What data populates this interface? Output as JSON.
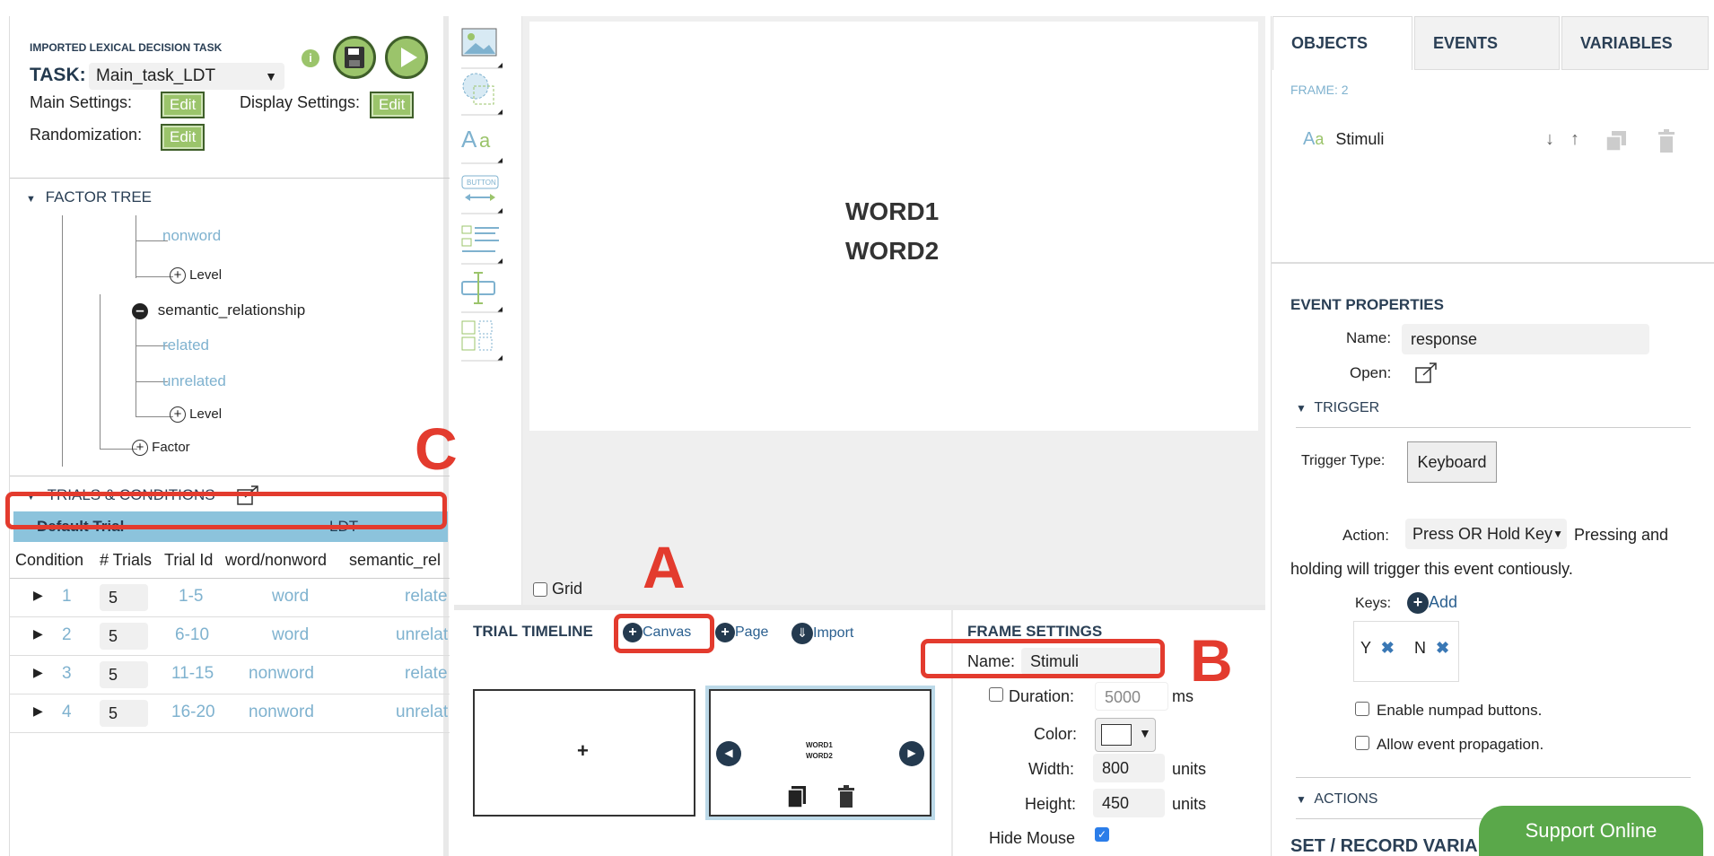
{
  "task": {
    "header": "IMPORTED LEXICAL DECISION TASK",
    "task_label": "TASK:",
    "task_value": "Main_task_LDT",
    "main_settings_label": "Main Settings:",
    "display_settings_label": "Display Settings:",
    "randomization_label": "Randomization:",
    "edit_label": "Edit"
  },
  "factor_tree": {
    "title": "FACTOR TREE",
    "items": [
      "nonword",
      "Level",
      "semantic_relationship",
      "related",
      "unrelated",
      "Level",
      "Factor"
    ]
  },
  "trials": {
    "title": "TRIALS & CONDITIONS",
    "default_trial": "Default Trial",
    "ldt": "LDT",
    "columns": [
      "Condition",
      "# Trials",
      "Trial Id",
      "word/nonword",
      "semantic_rel"
    ],
    "rows": [
      {
        "cond": "1",
        "n": "5",
        "id": "1-5",
        "wn": "word",
        "sem": "relate"
      },
      {
        "cond": "2",
        "n": "5",
        "id": "6-10",
        "wn": "word",
        "sem": "unrelat"
      },
      {
        "cond": "3",
        "n": "5",
        "id": "11-15",
        "wn": "nonword",
        "sem": "relate"
      },
      {
        "cond": "4",
        "n": "5",
        "id": "16-20",
        "wn": "nonword",
        "sem": "unrelat"
      }
    ]
  },
  "canvas": {
    "word1": "WORD1",
    "word2": "WORD2",
    "grid_label": "Grid"
  },
  "timeline": {
    "title": "TRIAL TIMELINE",
    "canvas_btn": "Canvas",
    "page_btn": "Page",
    "import_btn": "Import",
    "frame1_text": "+",
    "frame2_word1": "WORD1",
    "frame2_word2": "WORD2"
  },
  "frame_settings": {
    "title": "FRAME SETTINGS",
    "name_label": "Name:",
    "name_value": "Stimuli",
    "duration_label": "Duration:",
    "duration_value": "5000",
    "duration_unit": "ms",
    "color_label": "Color:",
    "width_label": "Width:",
    "width_value": "800",
    "height_label": "Height:",
    "height_value": "450",
    "units": "units",
    "hide_mouse_label": "Hide Mouse"
  },
  "right_panel": {
    "tabs": [
      "OBJECTS",
      "EVENTS",
      "VARIABLES"
    ],
    "frame_label": "FRAME: 2",
    "object_name": "Stimuli",
    "event_properties_title": "EVENT PROPERTIES",
    "name_label": "Name:",
    "name_value": "response",
    "open_label": "Open:",
    "trigger_title": "TRIGGER",
    "trigger_type_label": "Trigger Type:",
    "trigger_type_value": "Keyboard",
    "action_label": "Action:",
    "action_value": "Press OR Hold Key",
    "action_desc1": "Pressing and",
    "action_desc2": "holding will trigger this event contiously.",
    "keys_label": "Keys:",
    "add_label": "Add",
    "key1": "Y",
    "key2": "N",
    "numpad_label": "Enable numpad buttons.",
    "propagation_label": "Allow event propagation.",
    "actions_title": "ACTIONS",
    "set_record_title": "SET / RECORD VARIA",
    "support_label": "Support Online"
  },
  "annotations": {
    "a": "A",
    "b": "B",
    "c": "C"
  },
  "colors": {
    "green": "#9bc46b",
    "red": "#e33b2e",
    "accent_blue": "#7fb2cf",
    "header_blue": "#8cc3dc"
  }
}
